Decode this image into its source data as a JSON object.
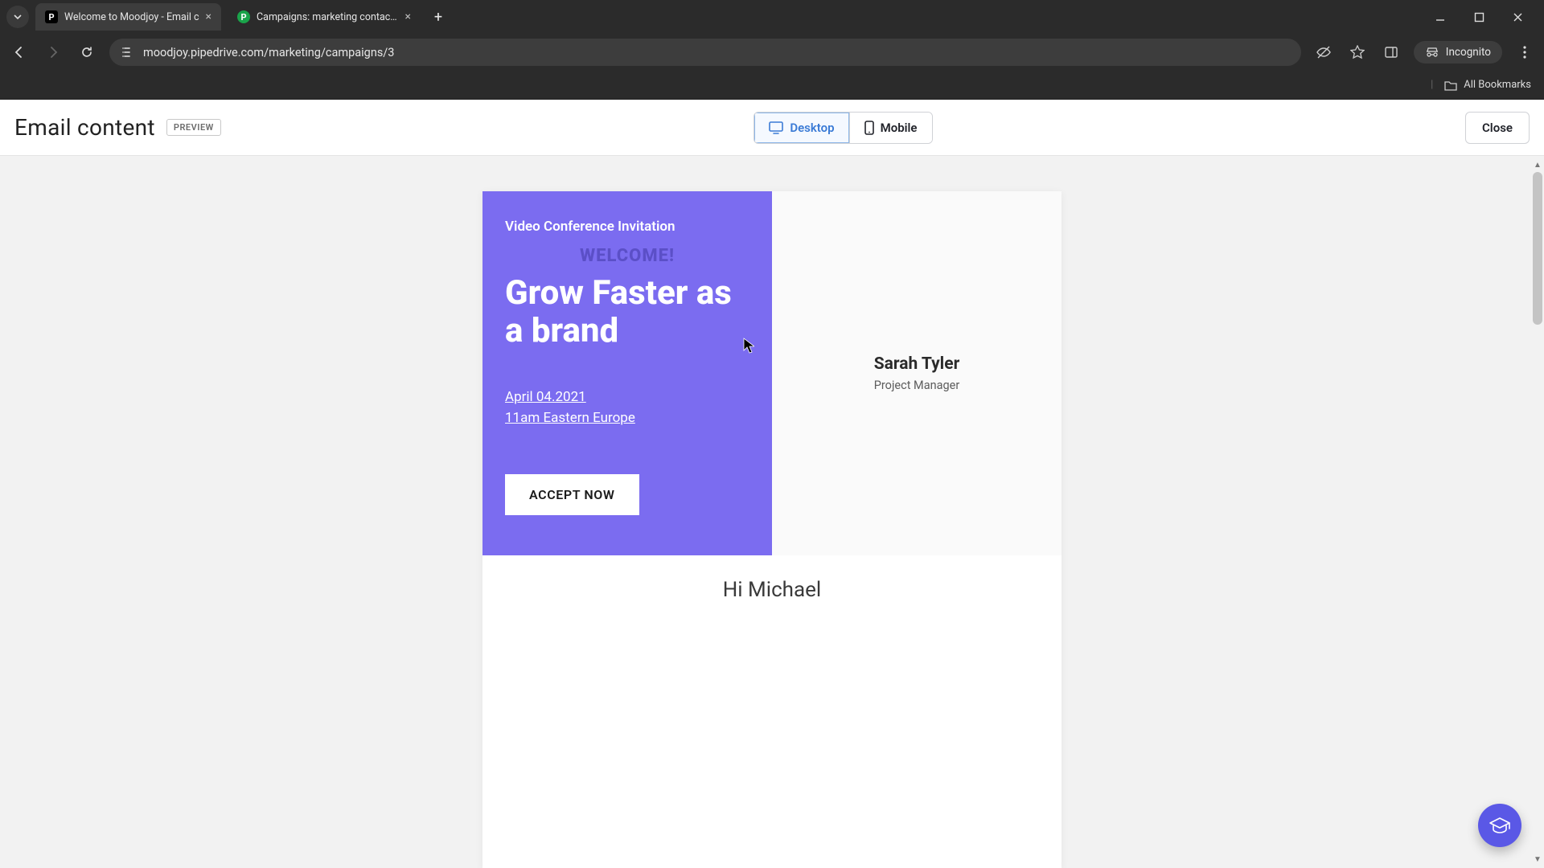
{
  "browser": {
    "tabs": [
      {
        "title": "Welcome to Moodjoy - Email c",
        "active": true
      },
      {
        "title": "Campaigns: marketing contacts",
        "active": false
      }
    ],
    "url": "moodjoy.pipedrive.com/marketing/campaigns/3",
    "incognito_label": "Incognito",
    "all_bookmarks": "All Bookmarks"
  },
  "header": {
    "title": "Email content",
    "badge": "PREVIEW",
    "switch_desktop": "Desktop",
    "switch_mobile": "Mobile",
    "close": "Close"
  },
  "email": {
    "pretitle": "Video Conference Invitation",
    "welcome": "WELCOME!",
    "headline": "Grow Faster as a brand",
    "date": "April 04.2021",
    "time": "11am Eastern Europe",
    "accept": "ACCEPT NOW",
    "presenter_name": "Sarah Tyler",
    "presenter_role": "Project Manager",
    "greeting": "Hi Michael"
  },
  "colors": {
    "hero_bg": "#7b6cf0",
    "accent_blue": "#3b7bd6",
    "fab_bg": "#5a58e6"
  }
}
